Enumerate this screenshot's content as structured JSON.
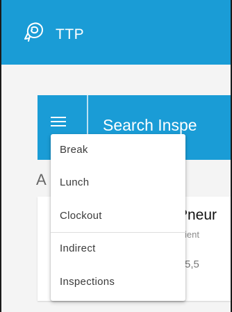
{
  "app": {
    "title": "TTP",
    "logo_icon": "rose-logo-icon",
    "brand_color": "#1a9cd6"
  },
  "search": {
    "label": "Search Inspe",
    "menu_icon": "hamburger-menu-icon"
  },
  "section": {
    "heading_fragment": "A"
  },
  "card": {
    "title_fragment": "Pneur",
    "subtitle_fragment": "ient",
    "value_fragment": "5,5"
  },
  "dropdown": {
    "items": [
      {
        "label": "Break"
      },
      {
        "label": "Lunch"
      },
      {
        "label": "Clockout"
      },
      {
        "label": "Indirect"
      },
      {
        "label": "Inspections"
      }
    ]
  }
}
